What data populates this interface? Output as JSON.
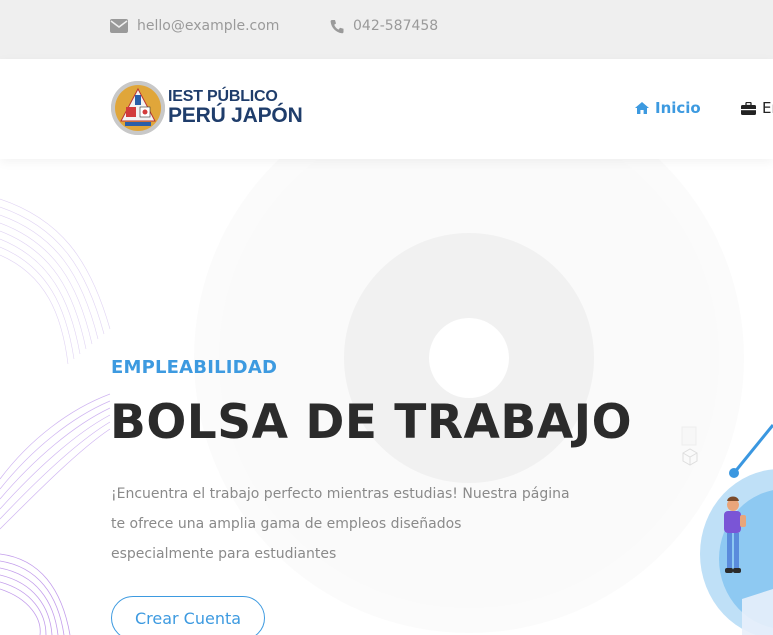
{
  "topbar": {
    "email": "hello@example.com",
    "phone": "042-587458",
    "email_icon": "envelope-icon",
    "phone_icon": "phone-icon"
  },
  "header": {
    "logo": {
      "line1": "IEST PÚBLICO",
      "line2": "PERÚ JAPÓN",
      "badge_icon": "institute-seal"
    },
    "nav": [
      {
        "label": "Inicio",
        "icon": "home-icon",
        "active": true
      },
      {
        "label": "Em",
        "icon": "briefcase-icon",
        "active": false
      }
    ]
  },
  "hero": {
    "eyebrow": "EMPLEABILIDAD",
    "title": "BOLSA DE TRABAJO",
    "description_lines": [
      "¡Encuentra el trabajo perfecto mientras estudias! Nuestra página",
      "te ofrece una amplia gama de empleos diseñados",
      "especialmente para estudiantes"
    ],
    "cta_label": "Crear Cuenta"
  },
  "colors": {
    "accent": "#3d9ae0",
    "title": "#2b2b2b",
    "muted": "#8a8a8a",
    "topbar_bg": "#efefef",
    "logo_text": "#1f3d6b"
  }
}
